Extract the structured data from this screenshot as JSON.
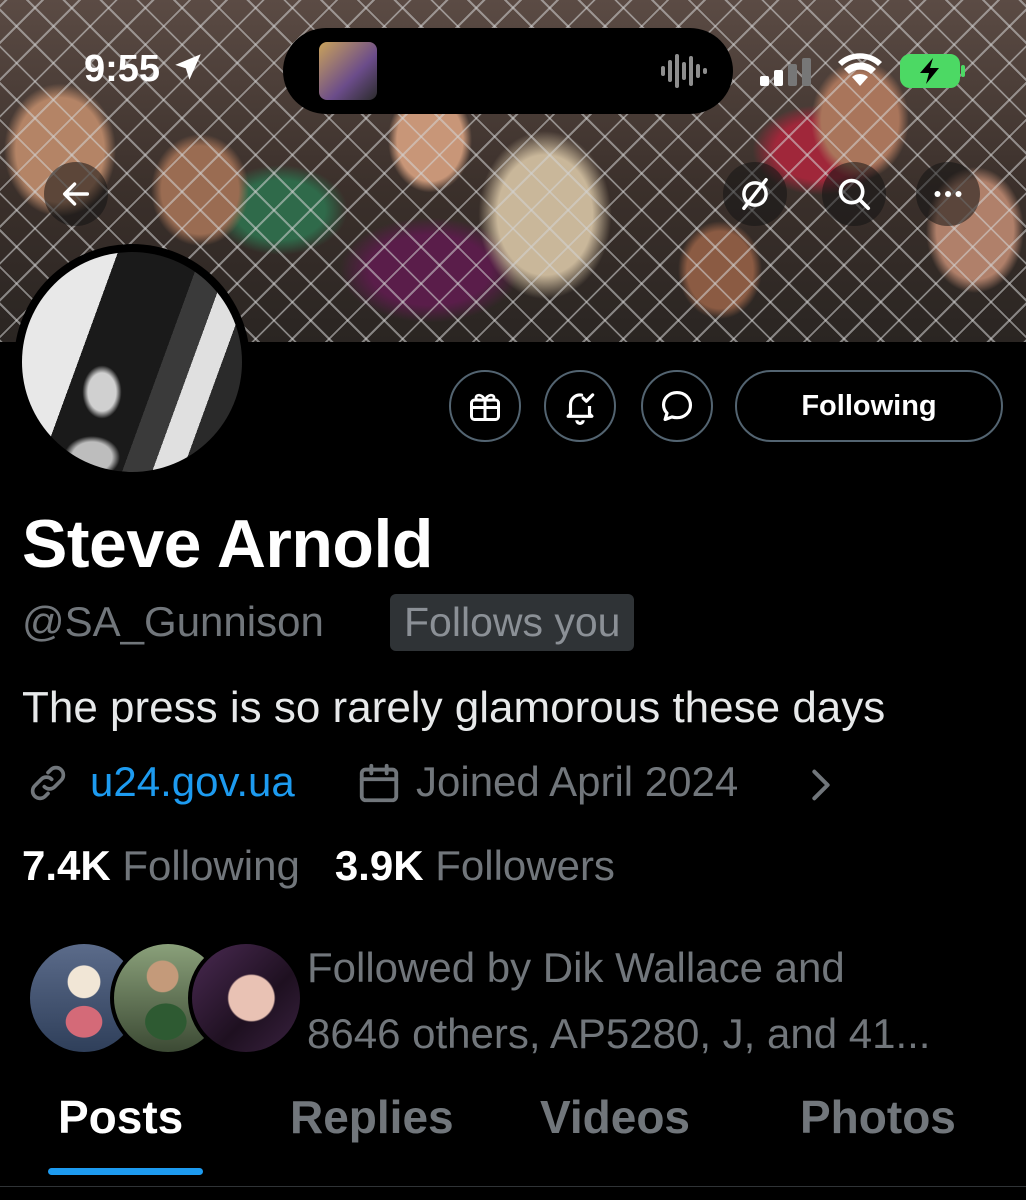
{
  "status_bar": {
    "time": "9:55",
    "icons": [
      "location-arrow-icon",
      "audio-waveform-icon",
      "cellular-signal-icon",
      "wifi-icon",
      "battery-charging-icon"
    ],
    "battery_color": "#4cd964"
  },
  "top_nav": {
    "icons": [
      "back-arrow-icon",
      "grok-icon",
      "search-icon",
      "more-icon"
    ]
  },
  "profile": {
    "display_name": "Steve Arnold",
    "handle": "@SA_Gunnison",
    "follows_you": "Follows you",
    "bio": "The press is so rarely glamorous these days",
    "website": "u24.gov.ua",
    "joined": "Joined April 2024",
    "following_count": "7.4K",
    "following_label": "Following",
    "followers_count": "3.9K",
    "followers_label": "Followers",
    "followed_by_line1": "Followed by Dik Wallace and",
    "followed_by_line2": "8646 others, AP5280, J, and 41..."
  },
  "actions": {
    "icons": [
      "gift-icon",
      "notification-bell-icon",
      "message-icon"
    ],
    "following_button": "Following"
  },
  "tabs": {
    "posts": "Posts",
    "replies": "Replies",
    "videos": "Videos",
    "photos": "Photos",
    "active": "Posts"
  },
  "colors": {
    "accent": "#1d9bf0",
    "background": "#000000",
    "secondary_text": "#71767b",
    "primary_text": "#e7e9ea"
  }
}
